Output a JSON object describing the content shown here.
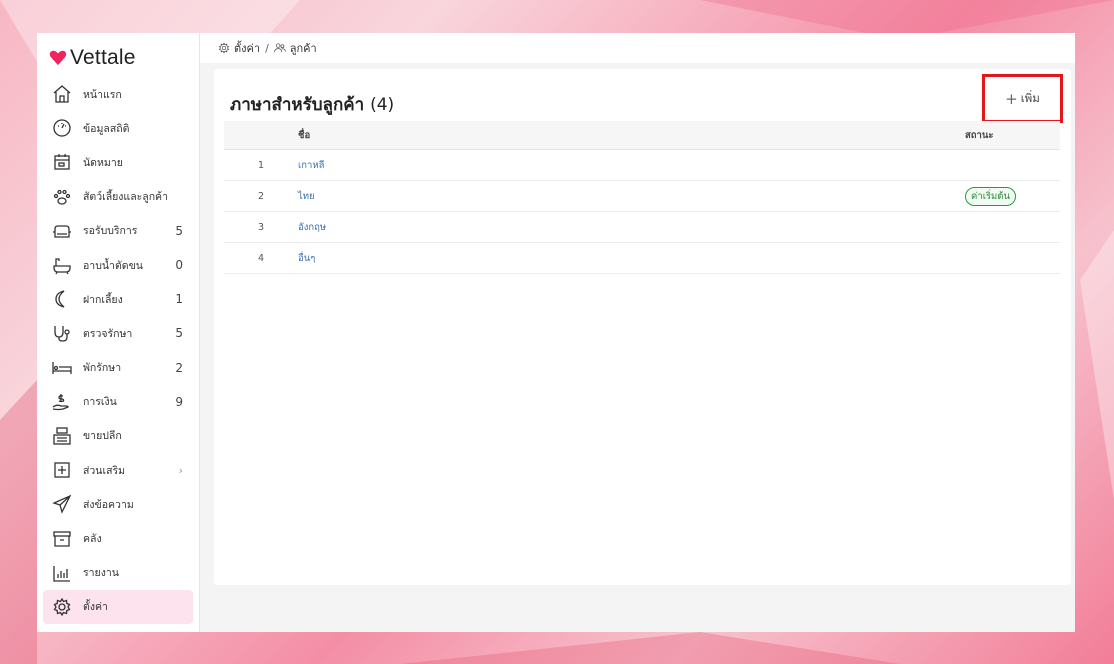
{
  "app": {
    "logo_text": "Vettale"
  },
  "sidebar": {
    "items": [
      {
        "label": "หน้าแรก",
        "count": "",
        "icon": "home-icon"
      },
      {
        "label": "ข้อมูลสถิติ",
        "count": "",
        "icon": "dashboard-icon"
      },
      {
        "label": "นัดหมาย",
        "count": "",
        "icon": "calendar-icon"
      },
      {
        "label": "สัตว์เลี้ยงและลูกค้า",
        "count": "",
        "icon": "paw-icon"
      },
      {
        "label": "รอรับบริการ",
        "count": "5",
        "icon": "sofa-icon"
      },
      {
        "label": "อาบน้ำตัดขน",
        "count": "0",
        "icon": "bathtub-icon"
      },
      {
        "label": "ฝากเลี้ยง",
        "count": "1",
        "icon": "moon-icon"
      },
      {
        "label": "ตรวจรักษา",
        "count": "5",
        "icon": "stethoscope-icon"
      },
      {
        "label": "พักรักษา",
        "count": "2",
        "icon": "bed-icon"
      },
      {
        "label": "การเงิน",
        "count": "9",
        "icon": "money-hand-icon"
      },
      {
        "label": "ขายปลีก",
        "count": "",
        "icon": "cash-register-icon"
      },
      {
        "label": "ส่วนเสริม",
        "count": "",
        "icon": "plus-box-icon",
        "chevron": "›"
      },
      {
        "label": "ส่งข้อความ",
        "count": "",
        "icon": "send-icon"
      },
      {
        "label": "คลัง",
        "count": "",
        "icon": "archive-icon"
      },
      {
        "label": "รายงาน",
        "count": "",
        "icon": "bar-chart-icon"
      },
      {
        "label": "ตั้งค่า",
        "count": "",
        "icon": "gear-icon",
        "active": true
      }
    ]
  },
  "breadcrumb": {
    "settings": "ตั้งค่า",
    "separator": "/",
    "customers": "ลูกค้า"
  },
  "card": {
    "title": "ภาษาสำหรับลูกค้า",
    "count": "(4)",
    "add_button": {
      "plus": "+",
      "label": "เพิ่ม"
    },
    "columns": {
      "name": "ชื่อ",
      "status": "สถานะ"
    },
    "rows": [
      {
        "index": "1",
        "name": "เกาหลี",
        "status": ""
      },
      {
        "index": "2",
        "name": "ไทย",
        "status": "ค่าเริ่มต้น"
      },
      {
        "index": "3",
        "name": "อังกฤษ",
        "status": ""
      },
      {
        "index": "4",
        "name": "อื่นๆ",
        "status": ""
      }
    ]
  },
  "colors": {
    "accent_pink": "#f0245e",
    "active_bg": "#fde3ee",
    "highlight_border": "#e3161c",
    "link_blue": "#3a6fb0",
    "badge_green": "#2a9a3a"
  }
}
